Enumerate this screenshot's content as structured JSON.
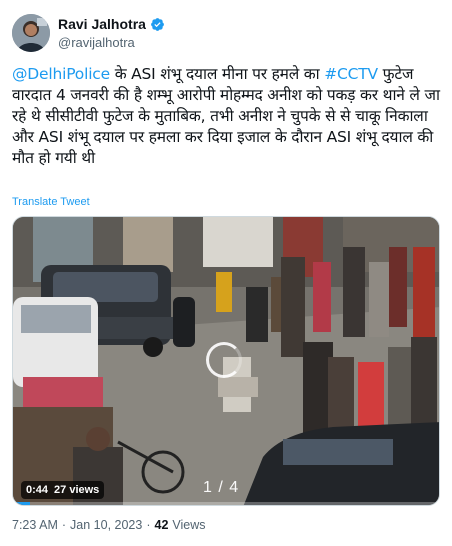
{
  "author": {
    "display_name": "Ravi Jalhotra",
    "handle": "@ravijalhotra",
    "verified": true,
    "verified_color": "#1d9bf0"
  },
  "tweet": {
    "mention": "@DelhiPolice",
    "text_1": " के ASI शंभू दयाल मीना पर हमले का ",
    "hashtag": "#CCTV",
    "text_2": " फुटेज वारदात 4 जनवरी की है शम्भू आरोपी मोहम्मद अनीश को पकड़ कर थाने ले जा रहे थे सीसीटीवी फुटेज के मुताबिक, तभी अनीश ने चुपके से से चाकू निकाला और ASI शंभू दयाल पर हमला कर दिया इजाल के दौरान ASI शंभू दयाल की मौत हो गयी थी",
    "translate_label": "Translate Tweet"
  },
  "media": {
    "elapsed": "0:44",
    "views": "27 views",
    "pager": "1 / 4",
    "progress_fraction": 0.04
  },
  "meta": {
    "time": "7:23 AM",
    "separator": "·",
    "date": "Jan 10, 2023",
    "views_count": "42",
    "views_label": "Views"
  },
  "colors": {
    "link": "#1d9bf0",
    "muted": "#536471",
    "text": "#0f1419"
  }
}
